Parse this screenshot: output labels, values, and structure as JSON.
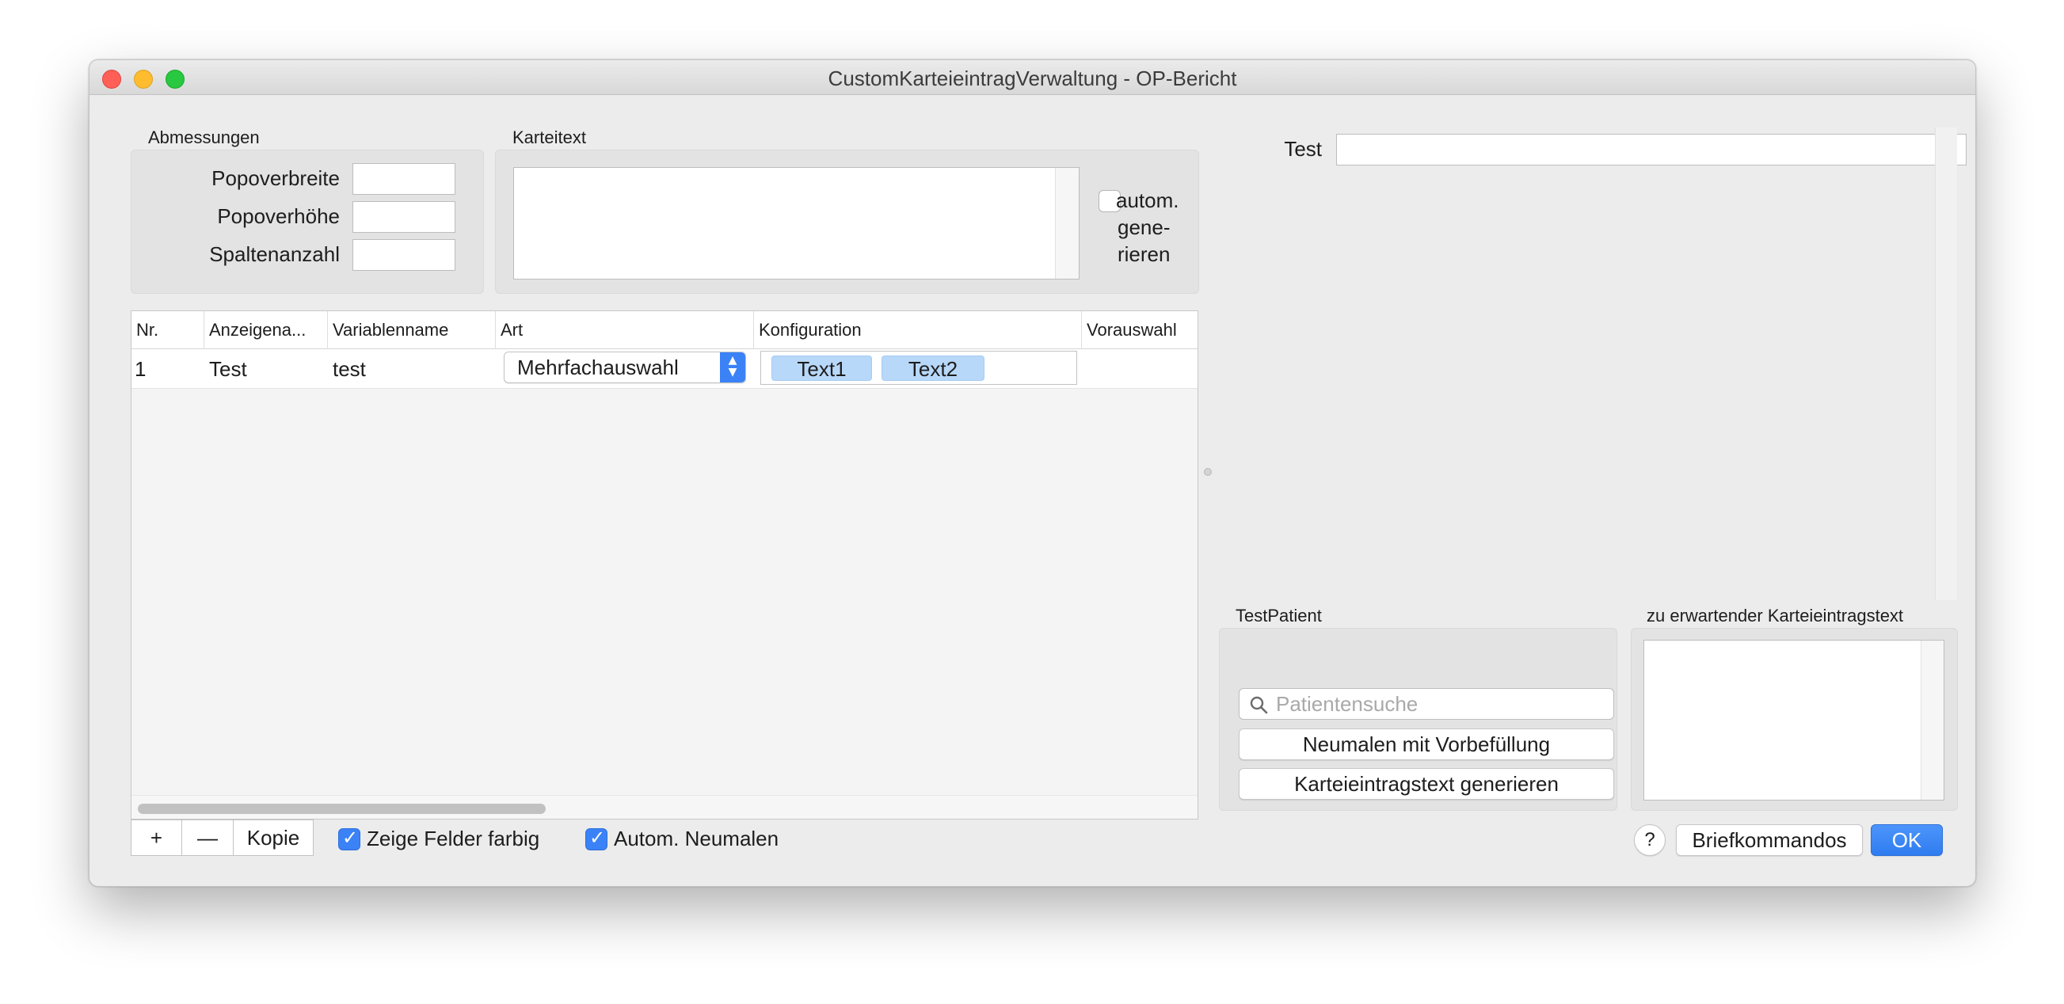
{
  "window": {
    "title": "CustomKarteieintragVerwaltung - OP-Bericht"
  },
  "dimensions": {
    "label": "Abmessungen",
    "fields": [
      {
        "label": "Popoverbreite",
        "value": ""
      },
      {
        "label": "Popoverhöhe",
        "value": ""
      },
      {
        "label": "Spaltenanzahl",
        "value": ""
      }
    ]
  },
  "karteitext": {
    "label": "Karteitext",
    "value": "",
    "auto_generate": {
      "label_line1": "autom.",
      "label_line2": "gene-",
      "label_line3": "rieren",
      "checked": false
    }
  },
  "table": {
    "columns": [
      "Nr.",
      "Anzeigena...",
      "Variablenname",
      "Art",
      "Konfiguration",
      "Vorauswahl"
    ],
    "rows": [
      {
        "nr": "1",
        "anzeigename": "Test",
        "variablenname": "test",
        "art": "Mehrfachauswahl",
        "konfiguration": [
          "Text1",
          "Text2"
        ],
        "vorauswahl": ""
      }
    ]
  },
  "toolbar": {
    "add_label": "+",
    "remove_label": "—",
    "copy_label": "Kopie",
    "show_colored": {
      "label": "Zeige Felder farbig",
      "checked": true
    },
    "auto_redraw": {
      "label": "Autom. Neumalen",
      "checked": true
    }
  },
  "preview": {
    "test_label": "Test",
    "test_value": ""
  },
  "test_patient": {
    "label": "TestPatient",
    "search_placeholder": "Patientensuche",
    "redraw_button": "Neumalen mit Vorbefüllung",
    "generate_button": "Karteieintragstext generieren"
  },
  "expected_text": {
    "label": "zu erwartender Karteieintragstext",
    "value": ""
  },
  "footer": {
    "help_label": "?",
    "briefkommandos_label": "Briefkommandos",
    "ok_label": "OK"
  },
  "colors": {
    "accent": "#3b82f6",
    "token_bg": "#b8d8f9",
    "window_bg": "#ececec"
  }
}
